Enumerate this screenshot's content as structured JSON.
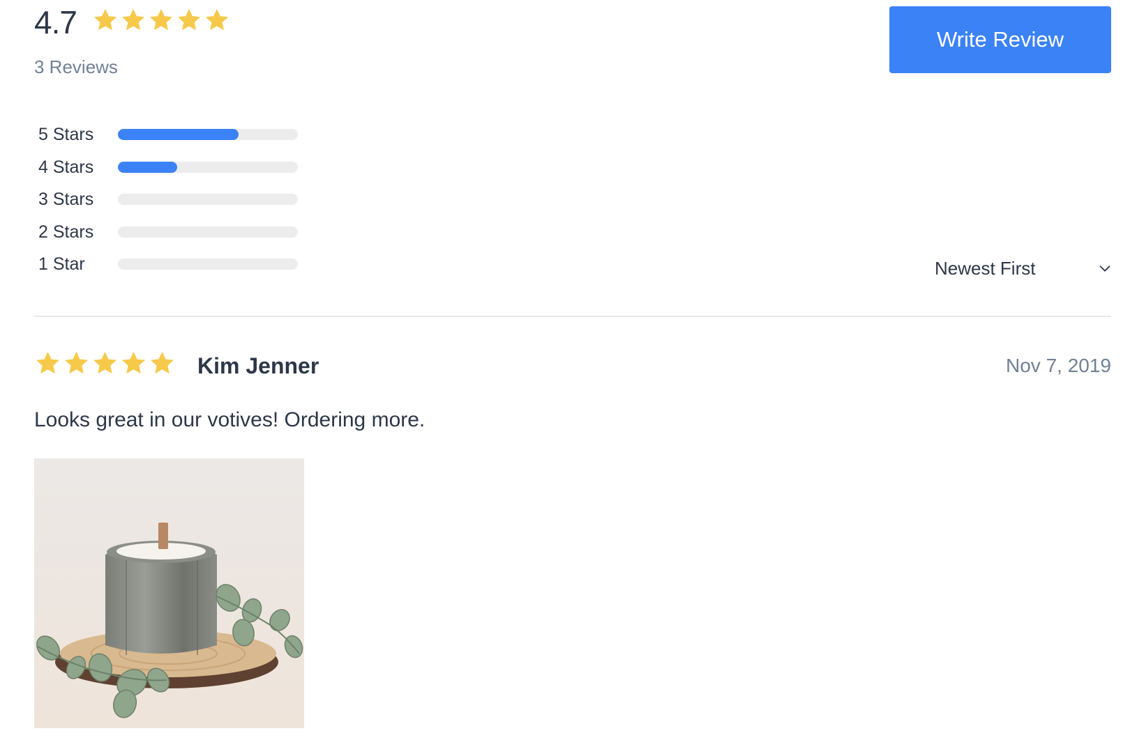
{
  "summary": {
    "average_rating": "4.7",
    "review_count_label": "3 Reviews",
    "stars_filled": 5
  },
  "write_review": {
    "label": "Write Review"
  },
  "distribution": [
    {
      "label": "5 Stars",
      "fraction": 0.67
    },
    {
      "label": "4 Stars",
      "fraction": 0.33
    },
    {
      "label": "3 Stars",
      "fraction": 0
    },
    {
      "label": "2 Stars",
      "fraction": 0
    },
    {
      "label": "1 Star",
      "fraction": 0
    }
  ],
  "sort": {
    "selected": "Newest First",
    "icon": "chevron-down-icon"
  },
  "reviews": [
    {
      "stars": 5,
      "author": "Kim Jenner",
      "date": "Nov 7, 2019",
      "body": "Looks great in our votives! Ordering more.",
      "photo_icon": "candle-photo"
    }
  ],
  "colors": {
    "accent": "#3b82f6",
    "star": "#f6c94a",
    "track": "#ececec",
    "text": "#2d3748",
    "muted": "#718096"
  }
}
